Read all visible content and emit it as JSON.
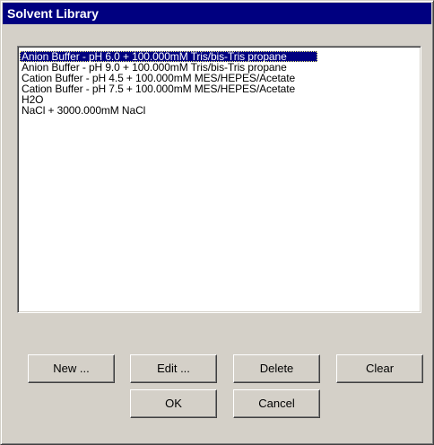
{
  "window": {
    "title": "Solvent Library"
  },
  "solvent_list": {
    "items": [
      "Anion Buffer - pH 6.0 + 100.000mM Tris/bis-Tris propane",
      "Anion Buffer - pH 9.0 + 100.000mM Tris/bis-Tris propane",
      "Cation Buffer - pH 4.5 + 100.000mM MES/HEPES/Acetate",
      "Cation Buffer - pH 7.5 + 100.000mM MES/HEPES/Acetate",
      "H2O",
      "NaCl + 3000.000mM NaCl"
    ],
    "selected_index": 0
  },
  "buttons": {
    "new_label": "New ...",
    "edit_label": "Edit ...",
    "delete_label": "Delete",
    "clear_label": "Clear",
    "ok_label": "OK",
    "cancel_label": "Cancel"
  },
  "colors": {
    "title_bar": "#000080",
    "selection": "#000080",
    "dialog_face": "#d4d0c8"
  }
}
